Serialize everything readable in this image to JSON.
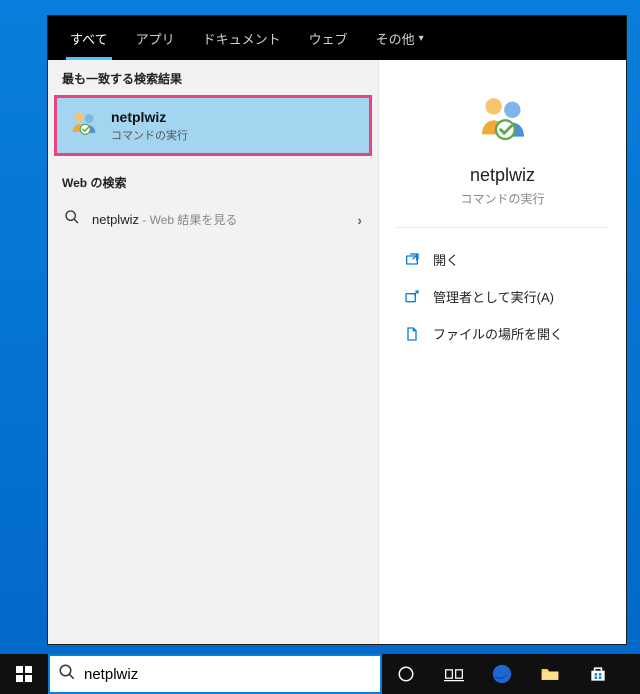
{
  "tabs": {
    "all": "すべて",
    "apps": "アプリ",
    "documents": "ドキュメント",
    "web": "ウェブ",
    "more": "その他"
  },
  "left": {
    "best_match_header": "最も一致する検索結果",
    "best_match": {
      "title": "netplwiz",
      "subtitle": "コマンドの実行"
    },
    "web_header": "Web の検索",
    "web_item": {
      "query": "netplwiz",
      "suffix": " - Web 結果を見る"
    }
  },
  "detail": {
    "title": "netplwiz",
    "subtitle": "コマンドの実行",
    "actions": {
      "open": "開く",
      "admin": "管理者として実行(A)",
      "location": "ファイルの場所を開く"
    }
  },
  "taskbar": {
    "search_value": "netplwiz"
  }
}
